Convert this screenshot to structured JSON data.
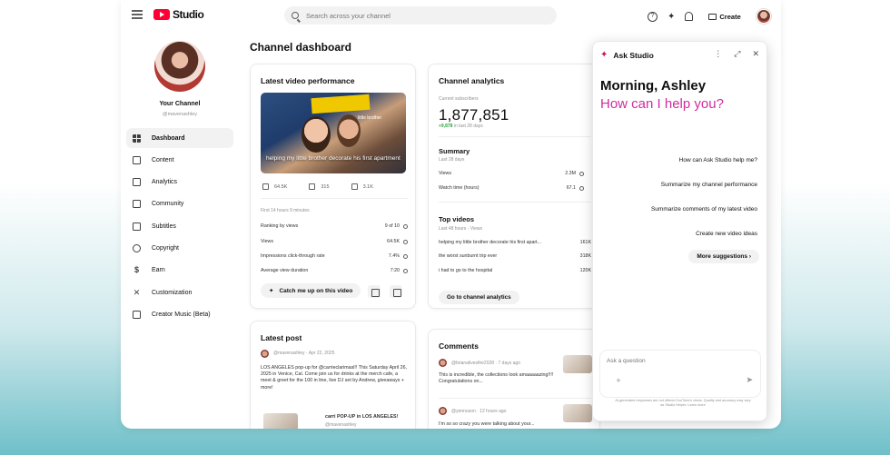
{
  "topbar": {
    "app_name": "Studio",
    "search_placeholder": "Search across your channel",
    "help_icon": "?",
    "create_label": "Create"
  },
  "sidebar": {
    "channel_name": "Your Channel",
    "channel_handle": "@mavenashley",
    "items": [
      {
        "label": "Dashboard",
        "icon": "dashboard-icon"
      },
      {
        "label": "Content",
        "icon": "content-icon"
      },
      {
        "label": "Analytics",
        "icon": "analytics-icon"
      },
      {
        "label": "Community",
        "icon": "community-icon"
      },
      {
        "label": "Subtitles",
        "icon": "subtitles-icon"
      },
      {
        "label": "Copyright",
        "icon": "copyright-icon"
      },
      {
        "label": "Earn",
        "icon": "earn-icon"
      },
      {
        "label": "Customization",
        "icon": "customization-icon"
      },
      {
        "label": "Creator Music (Beta)",
        "icon": "music-icon"
      }
    ]
  },
  "main": {
    "title": "Channel dashboard",
    "latest_video": {
      "title": "Latest video performance",
      "thumb_tag": "little brother",
      "thumb_caption": "helping my little brother decorate his first apartment",
      "stat_views": "64.5K",
      "stat_comments": "315",
      "stat_likes": "3.1K",
      "period": "First 14 hours 9 minutes",
      "rows": [
        {
          "label": "Ranking by views",
          "value": "9 of 10"
        },
        {
          "label": "Views",
          "value": "64.5K"
        },
        {
          "label": "Impressions click-through rate",
          "value": "7.4%"
        },
        {
          "label": "Average view duration",
          "value": "7:20"
        }
      ],
      "catch_up_label": "Catch me up on this video"
    },
    "analytics": {
      "title": "Channel analytics",
      "subs_label": "Current subscribers",
      "subs_value": "1,877,851",
      "subs_delta": "+9,878",
      "subs_delta_period": "in last 28 days",
      "summary_title": "Summary",
      "summary_period": "Last 28 days",
      "summary_rows": [
        {
          "label": "Views",
          "value": "2.3M"
        },
        {
          "label": "Watch time (hours)",
          "value": "67.1"
        }
      ],
      "top_title": "Top videos",
      "top_period": "Last 48 hours · Views",
      "top_rows": [
        {
          "label": "helping my little brother decorate his first apart...",
          "value": "161K"
        },
        {
          "label": "the worst sunburnt trip ever",
          "value": "318K"
        },
        {
          "label": "i had to go to the hospital",
          "value": "120K"
        }
      ],
      "go_button": "Go to channel analytics"
    },
    "latest_post": {
      "title": "Latest post",
      "author": "@mavenashley",
      "date": "Apr 22, 2025",
      "text": "LOS ANGELES pop-up for @carrieclarimasl!! This Saturday April 26, 2025 in Venice, Cal. Come join us for drinks at the merch cafe, a meet & greet for the 100 in line, live DJ set by Andrew, giveaways + more!",
      "attachment_title": "carri POP-UP in LOS ANGELES!",
      "attachment_author": "@mavenashley"
    },
    "comments": {
      "title": "Comments",
      "items": [
        {
          "author": "@brianalivesthe2028",
          "time": "7 days ago",
          "text": "This is incredible, the collections look amaaaaazing!!!! Congratulations on..."
        },
        {
          "author": "@yennuson",
          "time": "12 hours ago",
          "text": "I'm so so crazy you were talking about your..."
        }
      ]
    }
  },
  "ask_studio": {
    "title": "Ask Studio",
    "greeting": "Morning, Ashley",
    "prompt": "How can I help you?",
    "suggestions": [
      "How can Ask Studio help me?",
      "Summarize my channel performance",
      "Summarize comments of my latest video",
      "Create new video ideas"
    ],
    "more_label": "More suggestions",
    "input_placeholder": "Ask a question",
    "disclaimer": "AI-generated responses are not offered YouTube's views. Quality and accuracy may vary as Studio Helper. Learn more"
  },
  "colors": {
    "accent": "#d12b9f",
    "brand_red": "#ff0033",
    "positive": "#2ba640"
  }
}
